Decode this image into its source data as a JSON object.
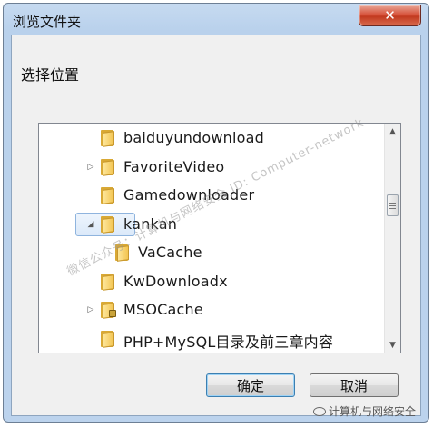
{
  "window": {
    "title": "浏览文件夹",
    "close_glyph": "✕"
  },
  "dialog": {
    "prompt": "选择位置"
  },
  "tree": {
    "items": [
      {
        "label": "baiduyundownload",
        "expander": "",
        "depth": 1,
        "icon": "folder-icon",
        "selected": false
      },
      {
        "label": "FavoriteVideo",
        "expander": "▷",
        "depth": 1,
        "icon": "folder-icon",
        "selected": false
      },
      {
        "label": "Gamedownloader",
        "expander": "",
        "depth": 1,
        "icon": "folder-icon",
        "selected": false
      },
      {
        "label": "kankan",
        "expander": "◢",
        "depth": 1,
        "icon": "folder-icon",
        "selected": true
      },
      {
        "label": "VaCache",
        "expander": "",
        "depth": 2,
        "icon": "folder-icon",
        "selected": false
      },
      {
        "label": "KwDownloadx",
        "expander": "",
        "depth": 1,
        "icon": "folder-icon",
        "selected": false
      },
      {
        "label": "MSOCache",
        "expander": "▷",
        "depth": 1,
        "icon": "locked-folder-icon",
        "selected": false
      },
      {
        "label": "PHP+MySQL目录及前三章内容",
        "expander": "",
        "depth": 1,
        "icon": "folder-icon",
        "selected": false
      }
    ],
    "scroll_up_glyph": "▲",
    "scroll_down_glyph": "▼"
  },
  "buttons": {
    "ok_label": "确定",
    "cancel_label": "取消"
  },
  "overlay": {
    "watermark": "微信公众号：计算机与网络安全  ID: Computer-network",
    "brand": "计算机与网络安全"
  }
}
